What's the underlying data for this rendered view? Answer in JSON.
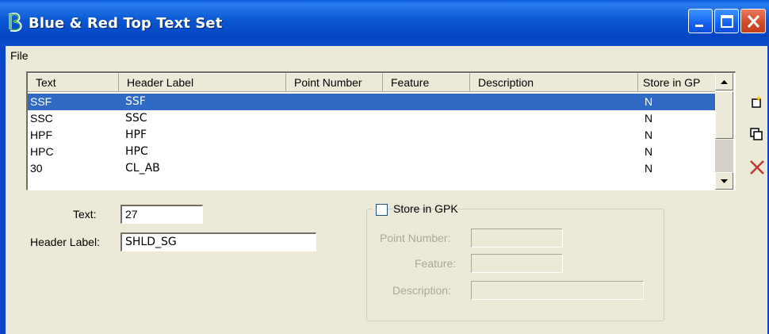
{
  "window": {
    "title": "Blue & Red Top Text Set",
    "icon": "b-app-icon",
    "controls": [
      "minimize-icon",
      "maximize-icon",
      "close-icon"
    ]
  },
  "menu": {
    "file": "File"
  },
  "table": {
    "columns": [
      "Text",
      "Header Label",
      "Point Number",
      "Feature",
      "Description",
      "Store in GP"
    ],
    "rows": [
      {
        "text": "SSF",
        "header_label": "SSF",
        "point_number": "",
        "feature": "",
        "description": "",
        "store": "N",
        "selected": true
      },
      {
        "text": "SSC",
        "header_label": "SSC",
        "point_number": "",
        "feature": "",
        "description": "",
        "store": "N"
      },
      {
        "text": "HPF",
        "header_label": "HPF",
        "point_number": "",
        "feature": "",
        "description": "",
        "store": "N"
      },
      {
        "text": "HPC",
        "header_label": "HPC",
        "point_number": "",
        "feature": "",
        "description": "",
        "store": "N"
      },
      {
        "text": "30",
        "header_label": "CL_AB",
        "point_number": "",
        "feature": "",
        "description": "",
        "store": "N"
      }
    ]
  },
  "side_buttons": [
    "new-item-icon",
    "copy-icon",
    "delete-icon"
  ],
  "form": {
    "text_label": "Text:",
    "text_value": "27",
    "header_label": "Header Label:",
    "header_value": "SHLD_SG"
  },
  "gpk": {
    "checkbox_label": "Store in GPK",
    "checked": false,
    "point_number_label": "Point Number:",
    "point_number_value": "",
    "feature_label": "Feature:",
    "feature_value": "",
    "description_label": "Description:",
    "description_value": ""
  },
  "colors": {
    "selection": "#316ac5",
    "titlebar": "#0a56d0",
    "close_button": "#d04a28",
    "delete_icon": "#c0392b"
  }
}
